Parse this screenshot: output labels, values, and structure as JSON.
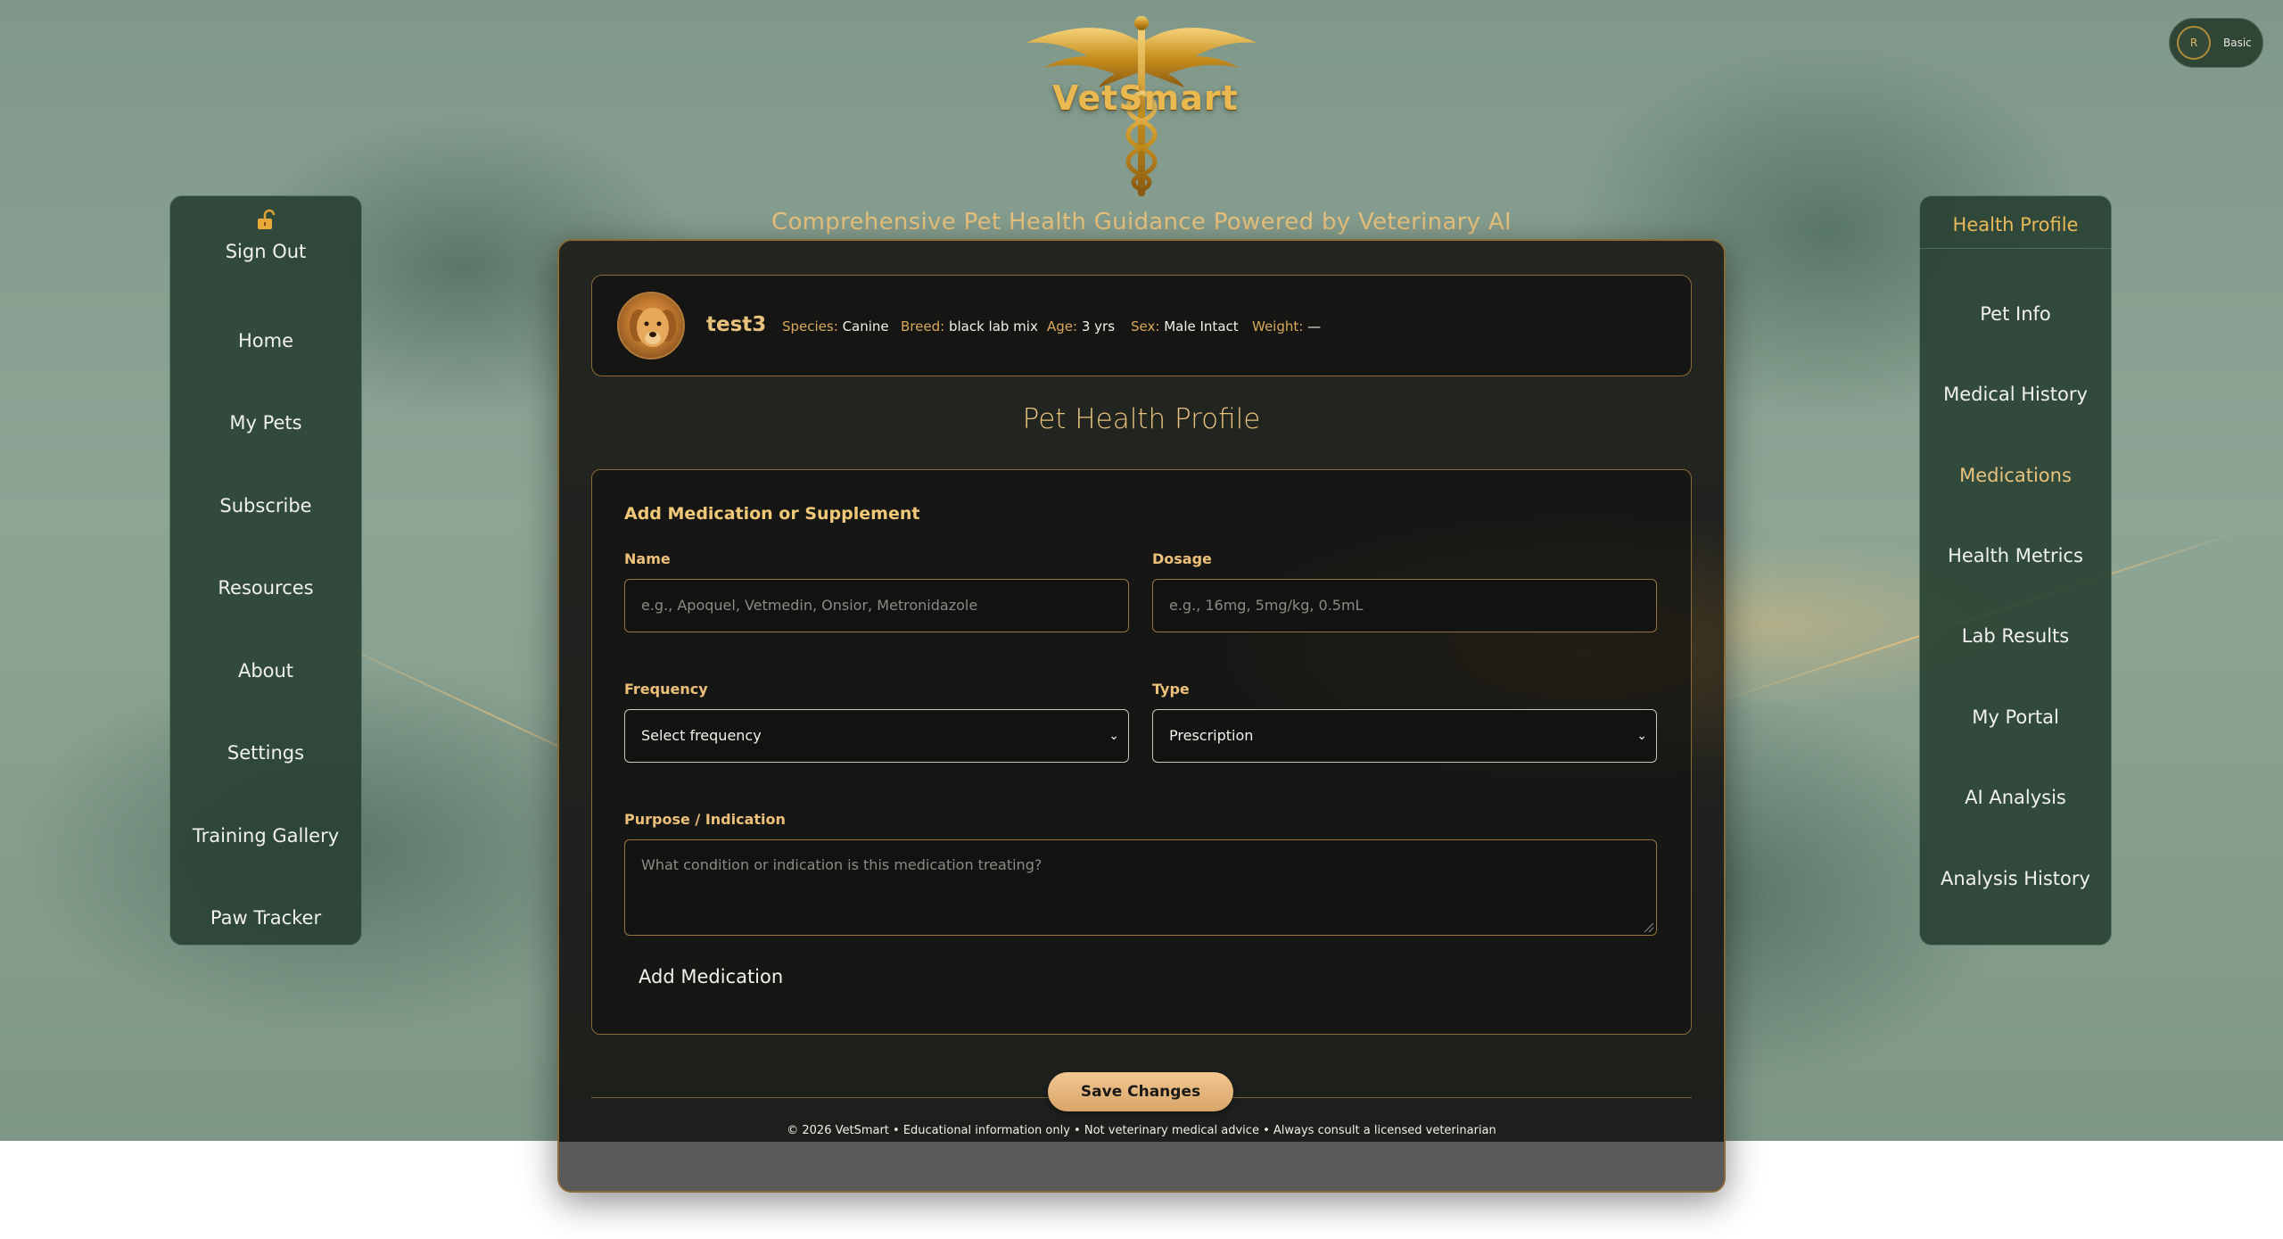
{
  "brand": {
    "name": "VetSmart",
    "tagline": "Comprehensive Pet Health Guidance Powered by Veterinary AI"
  },
  "account": {
    "initial": "R",
    "plan": "Basic"
  },
  "left_nav": {
    "items": [
      {
        "label": "Sign Out",
        "icon": "unlock-icon"
      },
      {
        "label": "Home"
      },
      {
        "label": "My Pets"
      },
      {
        "label": "Subscribe"
      },
      {
        "label": "Resources"
      },
      {
        "label": "About"
      },
      {
        "label": "Settings"
      },
      {
        "label": "Training Gallery"
      },
      {
        "label": "Paw Tracker"
      }
    ]
  },
  "right_nav": {
    "header": "Health Profile",
    "items": [
      {
        "label": "Pet Info"
      },
      {
        "label": "Medical History"
      },
      {
        "label": "Medications",
        "active": true
      },
      {
        "label": "Health Metrics"
      },
      {
        "label": "Lab Results"
      },
      {
        "label": "My Portal"
      },
      {
        "label": "AI Analysis"
      },
      {
        "label": "Analysis History"
      }
    ]
  },
  "pet": {
    "name": "test3",
    "species_label": "Species:",
    "species": "Canine",
    "breed_label": "Breed:",
    "breed": "black lab mix",
    "age_label": "Age:",
    "age": "3 yrs",
    "sex_label": "Sex:",
    "sex": "Male Intact",
    "weight_label": "Weight:",
    "weight": "—"
  },
  "page_title": "Pet Health Profile",
  "form": {
    "title": "Add Medication or Supplement",
    "name_label": "Name",
    "name_placeholder": "e.g., Apoquel, Vetmedin, Onsior, Metronidazole",
    "dosage_label": "Dosage",
    "dosage_placeholder": "e.g., 16mg, 5mg/kg, 0.5mL",
    "frequency_label": "Frequency",
    "frequency_value": "Select frequency",
    "type_label": "Type",
    "type_value": "Prescription",
    "purpose_label": "Purpose / Indication",
    "purpose_placeholder": "What condition or indication is this medication treating?",
    "add_button": "Add Medication"
  },
  "save_button": "Save Changes",
  "footer": "© 2026 VetSmart • Educational information only • Not veterinary medical advice • Always consult a licensed veterinarian",
  "colors": {
    "accent_gold": "#e8c27d",
    "panel_green": "#28403a",
    "card_dark": "#1d1f1c"
  }
}
